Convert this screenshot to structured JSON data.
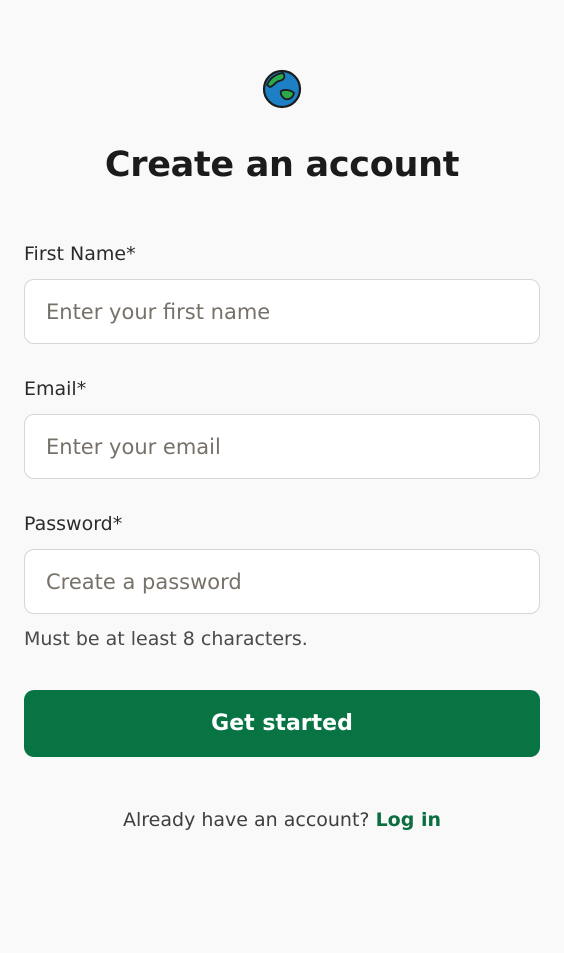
{
  "logo": {
    "icon": "globe-icon",
    "colors": {
      "ocean": "#1d7fc4",
      "land": "#2aa84a",
      "outline": "#1b1b1b"
    }
  },
  "page": {
    "title": "Create an account"
  },
  "form": {
    "first_name": {
      "label": "First Name*",
      "placeholder": "Enter your first name",
      "value": ""
    },
    "email": {
      "label": "Email*",
      "placeholder": "Enter your email",
      "value": ""
    },
    "password": {
      "label": "Password*",
      "placeholder": "Create a password",
      "value": "",
      "hint": "Must be at least 8 characters."
    },
    "submit_label": "Get started"
  },
  "footer": {
    "prompt": "Already have an account?",
    "login_label": "Log in"
  },
  "colors": {
    "background": "#f9f9f9",
    "primary": "#087443",
    "link": "#0b6e3f"
  }
}
